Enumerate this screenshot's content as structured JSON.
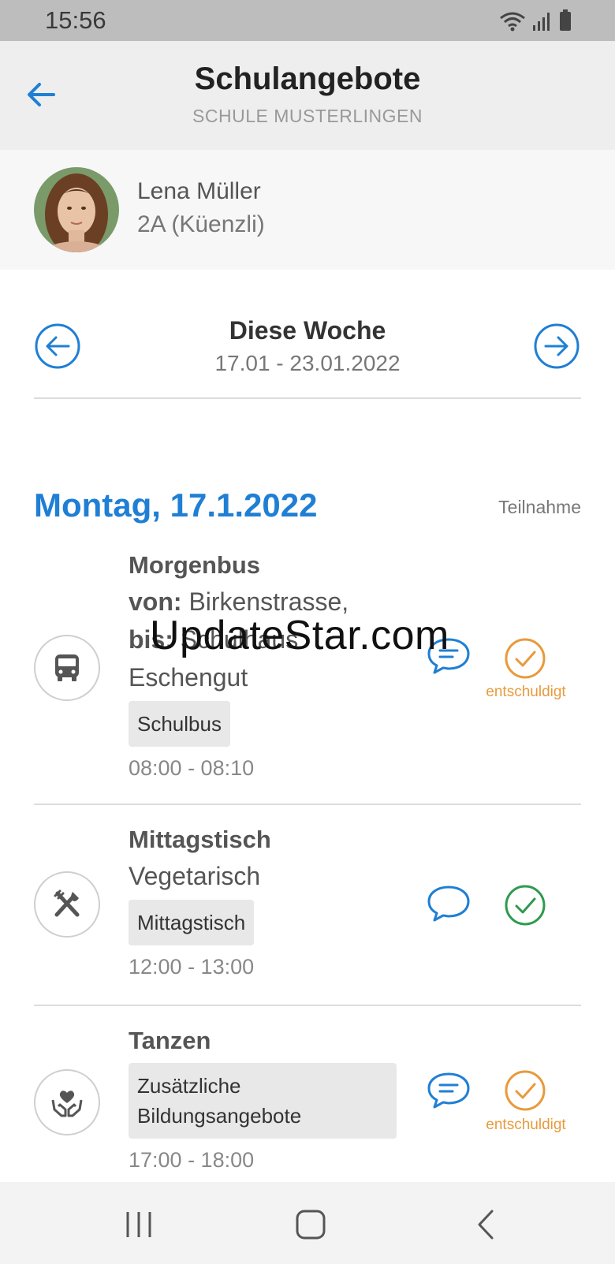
{
  "status_bar": {
    "time": "15:56"
  },
  "header": {
    "title": "Schulangebote",
    "subtitle": "SCHULE MUSTERLINGEN"
  },
  "profile": {
    "name": "Lena Müller",
    "class": "2A (Küenzli)"
  },
  "week": {
    "title": "Diese Woche",
    "dates": "17.01 - 23.01.2022"
  },
  "day": {
    "title": "Montag, 17.1.2022",
    "column_label": "Teilnahme"
  },
  "items": [
    {
      "title": "Morgenbus",
      "from_label": "von:",
      "from_value": "Birkenstrasse,",
      "to_label": "bis:",
      "to_value": "Schulhaus",
      "extra": "Eschengut",
      "tag": "Schulbus",
      "time": "08:00 - 08:10",
      "icon": "bus-icon",
      "status": "entschuldigt",
      "status_color": "#e89a3c"
    },
    {
      "title": "Mittagstisch",
      "subtitle": "Vegetarisch",
      "tag": "Mittagstisch",
      "time": "12:00 - 13:00",
      "icon": "cutlery-icon",
      "status": "",
      "status_color": "#2e9a4e"
    },
    {
      "title": "Tanzen",
      "tag": "Zusätzliche Bildungsangebote",
      "time": "17:00 - 18:00",
      "icon": "heart-hands-icon",
      "status": "entschuldigt",
      "status_color": "#e89a3c"
    }
  ],
  "watermark": "UpdateStar.com",
  "colors": {
    "accent": "#1f7fd4",
    "excused": "#e89a3c",
    "present": "#2e9a4e"
  }
}
